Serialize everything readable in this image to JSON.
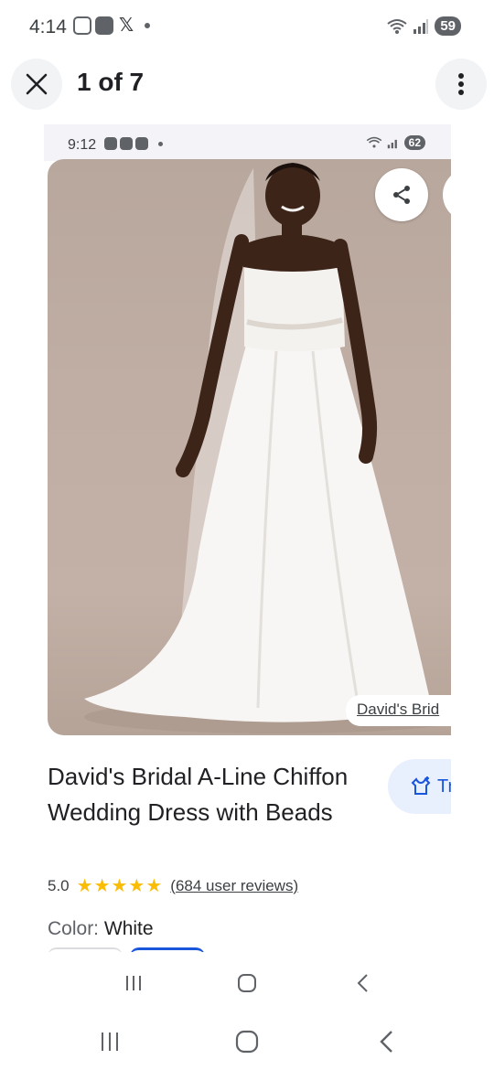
{
  "status_bar": {
    "time": "4:14",
    "battery": "59"
  },
  "header": {
    "counter": "1 of 7"
  },
  "screenshot": {
    "status_bar": {
      "time": "9:12",
      "battery": "62"
    },
    "image_source": "David's Brid",
    "product": {
      "title": "David's Bridal A-Line Chiffon Wedding Dress with Beads",
      "rating": "5.0",
      "stars": "★★★★★",
      "reviews": "(684 user reviews)",
      "color_label": "Color:",
      "color_value": "White"
    },
    "try_on_label": "Tr"
  },
  "colors": {
    "accent": "#1a56db",
    "star": "#fbbc04",
    "chip_bg": "#e8f0fe"
  },
  "icons": {
    "close": "close-icon",
    "more": "more-vert-icon",
    "share": "share-icon",
    "try_on": "try-on-icon",
    "recent": "recent-apps-icon",
    "home": "home-icon",
    "back": "back-icon"
  }
}
